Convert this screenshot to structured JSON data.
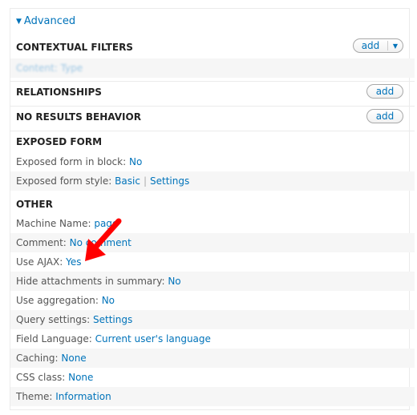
{
  "advanced": {
    "label": "Advanced",
    "icon": "triangle-down-icon"
  },
  "sections": {
    "contextual_filters": {
      "title": "CONTEXTUAL FILTERS",
      "add_label": "add",
      "dropdown_icon": "chevron-down-icon",
      "item": "Content: Type"
    },
    "relationships": {
      "title": "RELATIONSHIPS",
      "add_label": "add"
    },
    "no_results": {
      "title": "NO RESULTS BEHAVIOR",
      "add_label": "add"
    },
    "exposed_form": {
      "title": "EXPOSED FORM",
      "in_block_label": "Exposed form in block:",
      "in_block_value": "No",
      "style_label": "Exposed form style:",
      "style_value": "Basic",
      "style_sep": "|",
      "style_settings": "Settings"
    },
    "other": {
      "title": "OTHER",
      "items": [
        {
          "label": "Machine Name:",
          "value": "page"
        },
        {
          "label": "Comment:",
          "value": "No comment"
        },
        {
          "label": "Use AJAX:",
          "value": "Yes"
        },
        {
          "label": "Hide attachments in summary:",
          "value": "No"
        },
        {
          "label": "Use aggregation:",
          "value": "No"
        },
        {
          "label": "Query settings:",
          "value": "Settings"
        },
        {
          "label": "Field Language:",
          "value": "Current user's language"
        },
        {
          "label": "Caching:",
          "value": "None"
        },
        {
          "label": "CSS class:",
          "value": "None"
        },
        {
          "label": "Theme:",
          "value": "Information"
        }
      ]
    }
  },
  "annotation": {
    "icon": "red-arrow-icon",
    "color": "#ff0000"
  }
}
